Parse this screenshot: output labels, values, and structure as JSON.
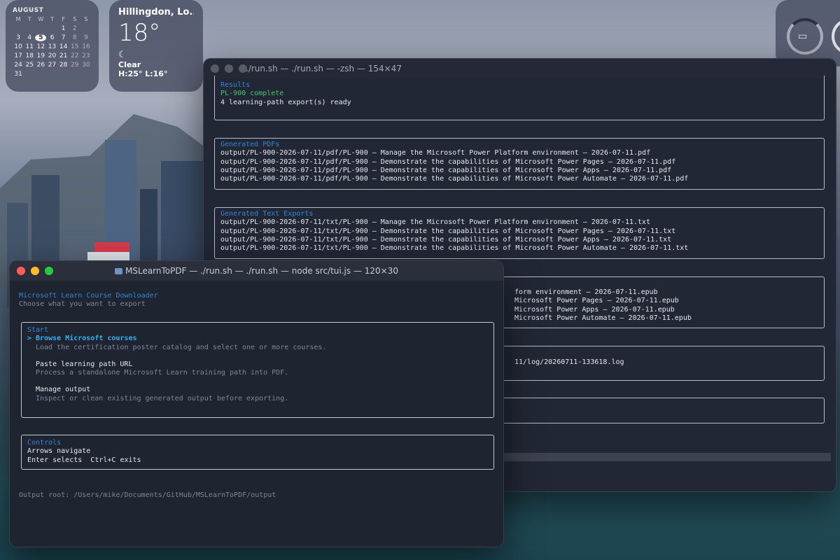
{
  "calendar": {
    "month": "AUGUST",
    "weekdays": [
      "M",
      "T",
      "W",
      "T",
      "F",
      "S",
      "S"
    ],
    "weeks": [
      [
        "",
        "",
        "",
        "",
        "1",
        "2",
        ""
      ],
      [
        "3",
        "4",
        "5",
        "6",
        "7",
        "8",
        "9"
      ],
      [
        "10",
        "11",
        "12",
        "13",
        "14",
        "15",
        "16"
      ],
      [
        "17",
        "18",
        "19",
        "20",
        "21",
        "22",
        "23"
      ],
      [
        "24",
        "25",
        "26",
        "27",
        "28",
        "29",
        "30"
      ],
      [
        "31",
        "",
        "",
        "",
        "",
        "",
        ""
      ]
    ],
    "today": "5"
  },
  "weather": {
    "location": "Hillingdon, Lo...",
    "temperature": "18°",
    "condition": "Clear",
    "high_low": "H:25° L:16°"
  },
  "back_terminal": {
    "title": "./run.sh — ./run.sh — -zsh — 154×47",
    "results": {
      "heading": "Results",
      "status": "PL-900 complete",
      "summary": "4 learning-path export(s) ready"
    },
    "pdfs": {
      "heading": "Generated PDFs",
      "lines": [
        "output/PL-900-2026-07-11/pdf/PL-900 – Manage the Microsoft Power Platform environment – 2026-07-11.pdf",
        "output/PL-900-2026-07-11/pdf/PL-900 – Demonstrate the capabilities of Microsoft Power Pages – 2026-07-11.pdf",
        "output/PL-900-2026-07-11/pdf/PL-900 – Demonstrate the capabilities of Microsoft Power Apps – 2026-07-11.pdf",
        "output/PL-900-2026-07-11/pdf/PL-900 – Demonstrate the capabilities of Microsoft Power Automate – 2026-07-11.pdf"
      ]
    },
    "txts": {
      "heading": "Generated Text Exports",
      "lines": [
        "output/PL-900-2026-07-11/txt/PL-900 – Manage the Microsoft Power Platform environment – 2026-07-11.txt",
        "output/PL-900-2026-07-11/txt/PL-900 – Demonstrate the capabilities of Microsoft Power Pages – 2026-07-11.txt",
        "output/PL-900-2026-07-11/txt/PL-900 – Demonstrate the capabilities of Microsoft Power Apps – 2026-07-11.txt",
        "output/PL-900-2026-07-11/txt/PL-900 – Demonstrate the capabilities of Microsoft Power Automate – 2026-07-11.txt"
      ]
    },
    "epubs": {
      "lines": [
        "form environment – 2026-07-11.epub",
        "Microsoft Power Pages – 2026-07-11.epub",
        "Microsoft Power Apps – 2026-07-11.epub",
        "Microsoft Power Automate – 2026-07-11.epub"
      ]
    },
    "log": {
      "line": "11/log/20260711-133618.log"
    }
  },
  "front_terminal": {
    "title": "MSLearnToPDF — ./run.sh — ./run.sh — node src/tui.js — 120×30",
    "app_title": "Microsoft Learn Course Downloader",
    "app_subtitle": "Choose what you want to export",
    "start": {
      "heading": "Start",
      "options": [
        {
          "label": "> Browse Microsoft courses",
          "description": "Load the certification poster catalog and select one or more courses."
        },
        {
          "label": "Paste learning path URL",
          "description": "Process a standalone Microsoft Learn training path into PDF."
        },
        {
          "label": "Manage output",
          "description": "Inspect or clean existing generated output before exporting."
        }
      ]
    },
    "controls": {
      "heading": "Controls",
      "line1": "Arrows navigate",
      "line2": "Enter selects  Ctrl+C exits"
    },
    "output_root": "Output root: /Users/mike/Documents/GitHub/MSLearnToPDF/output"
  },
  "colors": {
    "close": "#ff5f57",
    "minimize": "#febc2e",
    "zoom": "#28c840",
    "accent_blue": "#2f86d8",
    "selected_cyan": "#36b0f0",
    "success_green": "#46c46c"
  }
}
